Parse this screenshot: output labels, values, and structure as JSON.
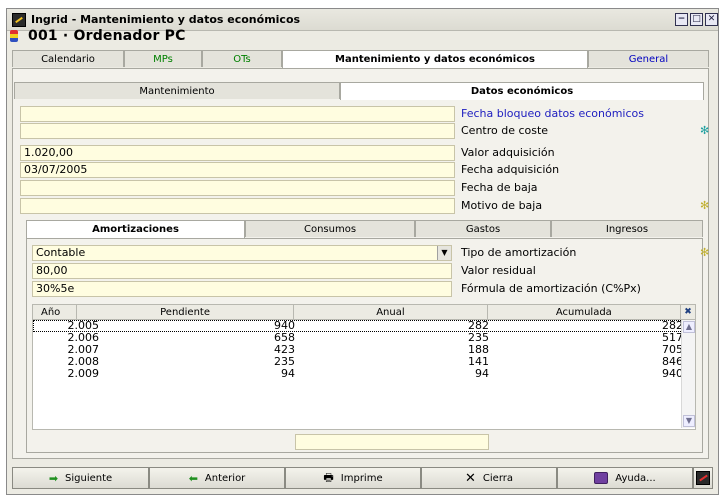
{
  "window": {
    "title": "Ingrid - Mantenimiento y datos económicos",
    "minimize_glyph": "−",
    "maximize_glyph": "□",
    "close_glyph": "✕"
  },
  "record": {
    "title": "001 · Ordenador PC"
  },
  "main_tabs": [
    {
      "label": "Calendario"
    },
    {
      "label": "MPs"
    },
    {
      "label": "OTs"
    },
    {
      "label": "Mantenimiento y datos económicos",
      "active": true
    },
    {
      "label": "General"
    }
  ],
  "sub_tabs": [
    {
      "label": "Mantenimiento"
    },
    {
      "label": "Datos económicos",
      "active": true
    }
  ],
  "fields": [
    {
      "value": "",
      "label": "Fecha bloqueo datos económicos",
      "label_style": "link"
    },
    {
      "value": "",
      "label": "Centro de coste",
      "marker": "✻",
      "marker_color": "#20a0a0"
    },
    {
      "value": "1.020,00",
      "label": "Valor adquisición"
    },
    {
      "value": "03/07/2005",
      "label": "Fecha adquisición"
    },
    {
      "value": "",
      "label": "Fecha de baja"
    },
    {
      "value": "",
      "label": "Motivo de baja",
      "marker": "✻",
      "marker_color": "#c0b030"
    }
  ],
  "inner_tabs": [
    {
      "label": "Amortizaciones",
      "active": true
    },
    {
      "label": "Consumos"
    },
    {
      "label": "Gastos"
    },
    {
      "label": "Ingresos"
    }
  ],
  "amortizacion": {
    "tipo_value": "Contable",
    "tipo_label": "Tipo de amortización",
    "tipo_marker": "✻",
    "residual_value": "80,00",
    "residual_label": "Valor residual",
    "formula_value": "30%5e",
    "formula_label": "Fórmula de amortización (C%Px)"
  },
  "grid": {
    "columns": [
      "Año",
      "Pendiente",
      "Anual",
      "Acumulada"
    ],
    "rows": [
      [
        "2.005",
        "940",
        "282",
        "282"
      ],
      [
        "2.006",
        "658",
        "235",
        "517"
      ],
      [
        "2.007",
        "423",
        "188",
        "705"
      ],
      [
        "2.008",
        "235",
        "141",
        "846"
      ],
      [
        "2.009",
        "94",
        "94",
        "940"
      ]
    ],
    "total_value": ""
  },
  "buttons": {
    "siguiente": "Siguiente",
    "anterior": "Anterior",
    "imprime": "Imprime",
    "cierra": "Cierra",
    "ayuda": "Ayuda..."
  }
}
